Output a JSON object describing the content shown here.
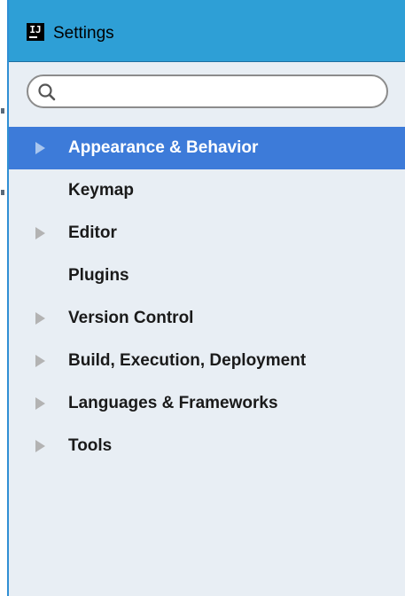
{
  "window": {
    "title": "Settings",
    "app_icon_text": "IJ"
  },
  "search": {
    "value": "",
    "placeholder": ""
  },
  "tree": {
    "items": [
      {
        "label": "Appearance & Behavior",
        "expandable": true,
        "selected": true
      },
      {
        "label": "Keymap",
        "expandable": false,
        "selected": false
      },
      {
        "label": "Editor",
        "expandable": true,
        "selected": false
      },
      {
        "label": "Plugins",
        "expandable": false,
        "selected": false
      },
      {
        "label": "Version Control",
        "expandable": true,
        "selected": false
      },
      {
        "label": "Build, Execution, Deployment",
        "expandable": true,
        "selected": false
      },
      {
        "label": "Languages & Frameworks",
        "expandable": true,
        "selected": false
      },
      {
        "label": "Tools",
        "expandable": true,
        "selected": false
      }
    ]
  },
  "colors": {
    "titlebar": "#2e9fd6",
    "panel_background": "#e8eef4",
    "selection": "#3d7bd9"
  }
}
